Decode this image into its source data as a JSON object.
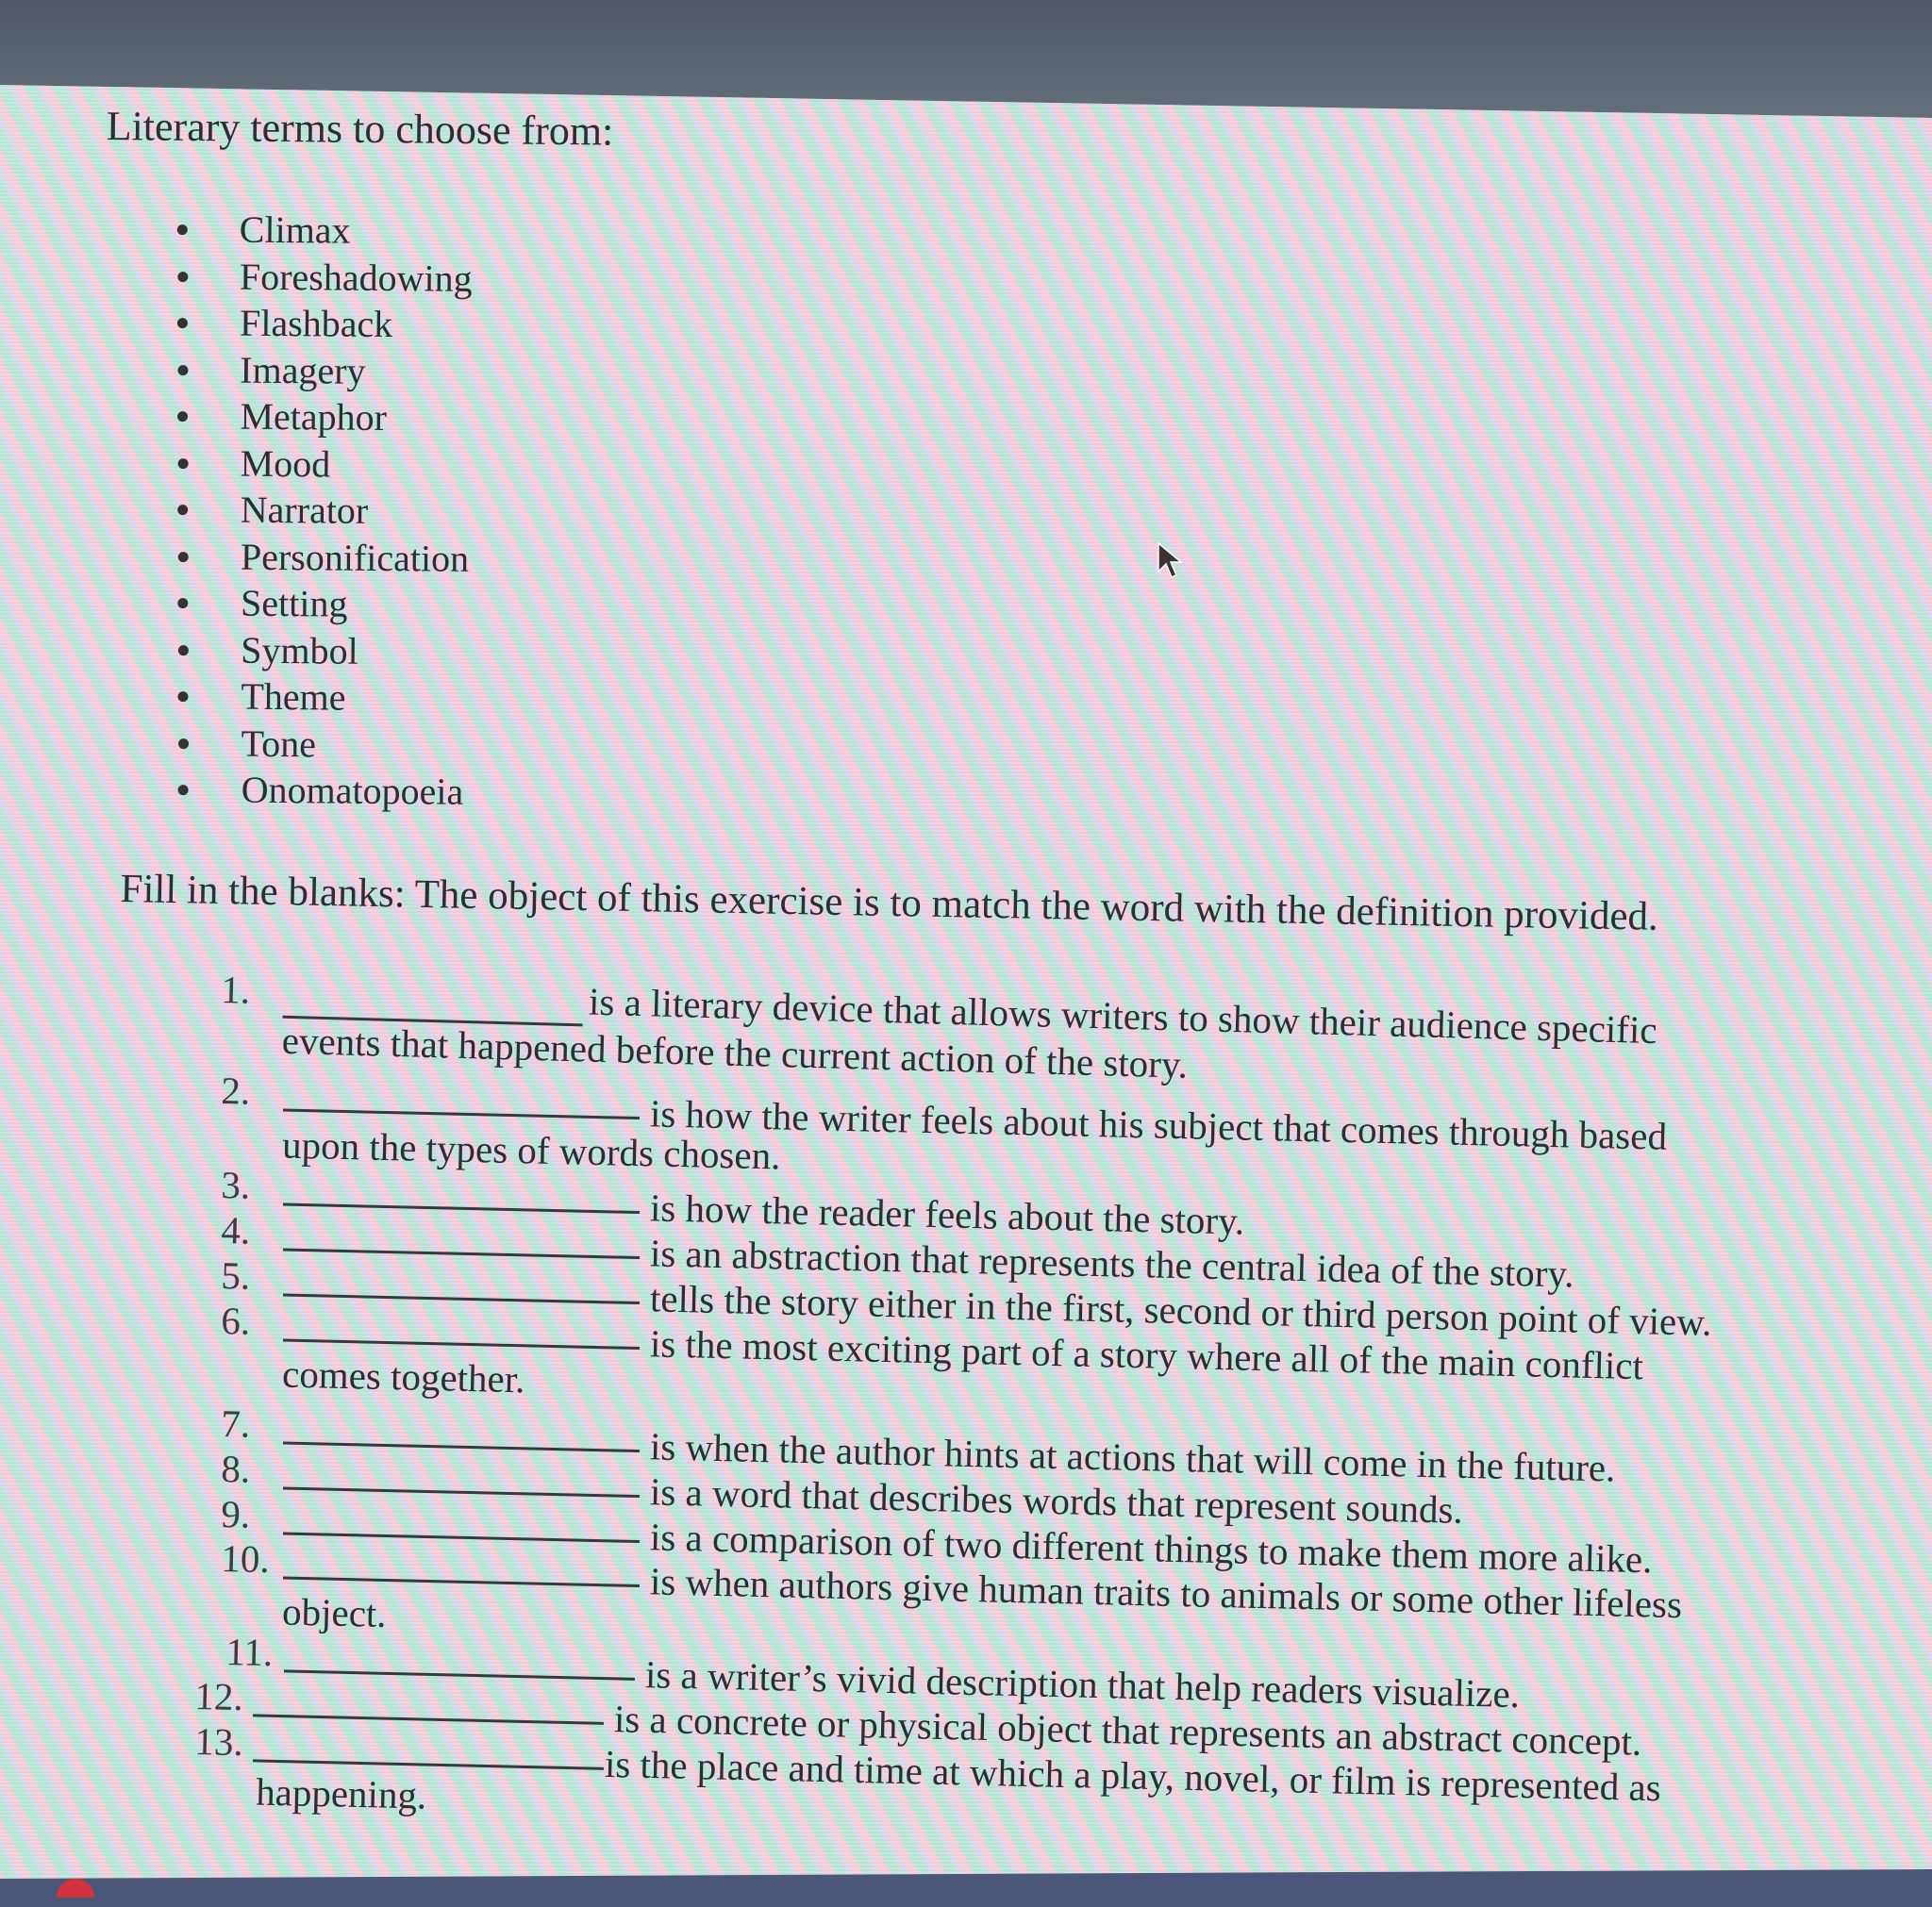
{
  "document": {
    "heading": "Literary terms to choose from:",
    "terms": [
      "Climax",
      "Foreshadowing",
      "Flashback",
      "Imagery",
      "Metaphor",
      "Mood",
      "Narrator",
      "Personification",
      "Setting",
      "Symbol",
      "Theme",
      "Tone",
      "Onomatopoeia"
    ],
    "instructions": "Fill in the blanks: The object of this exercise is to match the word with the definition provided.",
    "questions": [
      {
        "number": "1.",
        "definition": "is a literary device that allows writers to show their audience specific",
        "continuation": "events that happened before the current action of the story.",
        "answer": ""
      },
      {
        "number": "2.",
        "definition": "is how the writer feels about his subject that comes through based",
        "continuation": "upon the types of words chosen.",
        "answer": ""
      },
      {
        "number": "3.",
        "definition": "is how the reader feels about the story.",
        "continuation": "",
        "answer": ""
      },
      {
        "number": "4.",
        "definition": "is an abstraction that represents the central idea of the story.",
        "continuation": "",
        "answer": ""
      },
      {
        "number": "5.",
        "definition": "tells the story either in the first, second or third person point of view.",
        "continuation": "",
        "answer": ""
      },
      {
        "number": "6.",
        "definition": "is the most exciting part of a story where all of the main conflict",
        "continuation": "comes together.",
        "answer": ""
      },
      {
        "number": "7.",
        "definition": "is when the author hints at actions that will come in the future.",
        "continuation": "",
        "answer": ""
      },
      {
        "number": "8.",
        "definition": "is a word that describes words that represent sounds.",
        "continuation": "",
        "answer": ""
      },
      {
        "number": "9.",
        "definition": "is a comparison of two different things to make them more alike.",
        "continuation": "",
        "answer": ""
      },
      {
        "number": "10.",
        "definition": "is when authors give human traits to animals or some other lifeless",
        "continuation": "object.",
        "answer": ""
      },
      {
        "number": "11.",
        "definition": "is a writer’s vivid description that help readers visualize.",
        "continuation": "",
        "answer": ""
      },
      {
        "number": "12.",
        "definition": "is a concrete or physical object that represents an abstract concept.",
        "continuation": "",
        "answer": ""
      },
      {
        "number": "13.",
        "definition": "is the place and time at which a play, novel, or film is represented as",
        "continuation": "happening.",
        "answer": ""
      }
    ]
  },
  "colors": {
    "text": "#2b2f33",
    "bezel": "#5f6b78",
    "moire_pink": "#ffb6cd",
    "moire_green": "#96e1c8"
  },
  "icons": {
    "cursor": "mouse-pointer-icon",
    "bullet": "bullet-dot-icon"
  }
}
